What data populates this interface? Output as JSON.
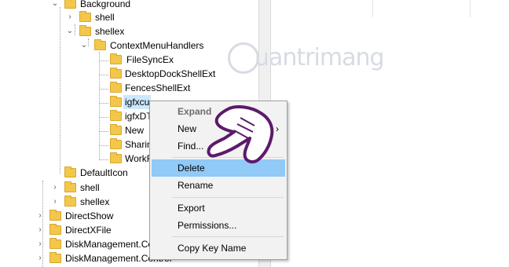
{
  "tree": {
    "items": [
      {
        "label": "Background",
        "expanded": true
      },
      {
        "label": "shell",
        "expanded": false
      },
      {
        "label": "shellex",
        "expanded": true
      },
      {
        "label": "ContextMenuHandlers",
        "expanded": true
      },
      {
        "label": "FileSyncEx"
      },
      {
        "label": "DesktopDockShellExt"
      },
      {
        "label": "FencesShellExt"
      },
      {
        "label": "igfxcu",
        "selected": true
      },
      {
        "label": "igfxDT"
      },
      {
        "label": "New"
      },
      {
        "label": "Sharin"
      },
      {
        "label": "WorkF"
      },
      {
        "label": "DefaultIcon"
      },
      {
        "label": "shell",
        "expanded": false
      },
      {
        "label": "shellex",
        "expanded": false
      },
      {
        "label": "DirectShow",
        "expanded": false
      },
      {
        "label": "DirectXFile",
        "expanded": false
      },
      {
        "label": "DiskManagement.Co",
        "expanded": false
      },
      {
        "label": "DiskManagement.Control",
        "expanded": false
      }
    ]
  },
  "context_menu": {
    "items": [
      {
        "label": "Expand",
        "bold": true
      },
      {
        "label": "New",
        "submenu_arrow": "›"
      },
      {
        "label": "Find..."
      },
      {
        "label": "Delete",
        "highlighted": true
      },
      {
        "label": "Rename"
      },
      {
        "label": "Export"
      },
      {
        "label": "Permissions..."
      },
      {
        "label": "Copy Key Name"
      }
    ]
  },
  "watermark": {
    "text": "uantrimang"
  },
  "colors": {
    "folder": "#f3c74a",
    "selection": "#cce8ff",
    "menu_highlight": "#91c9f7",
    "menu_bg": "#f2f2f2"
  }
}
